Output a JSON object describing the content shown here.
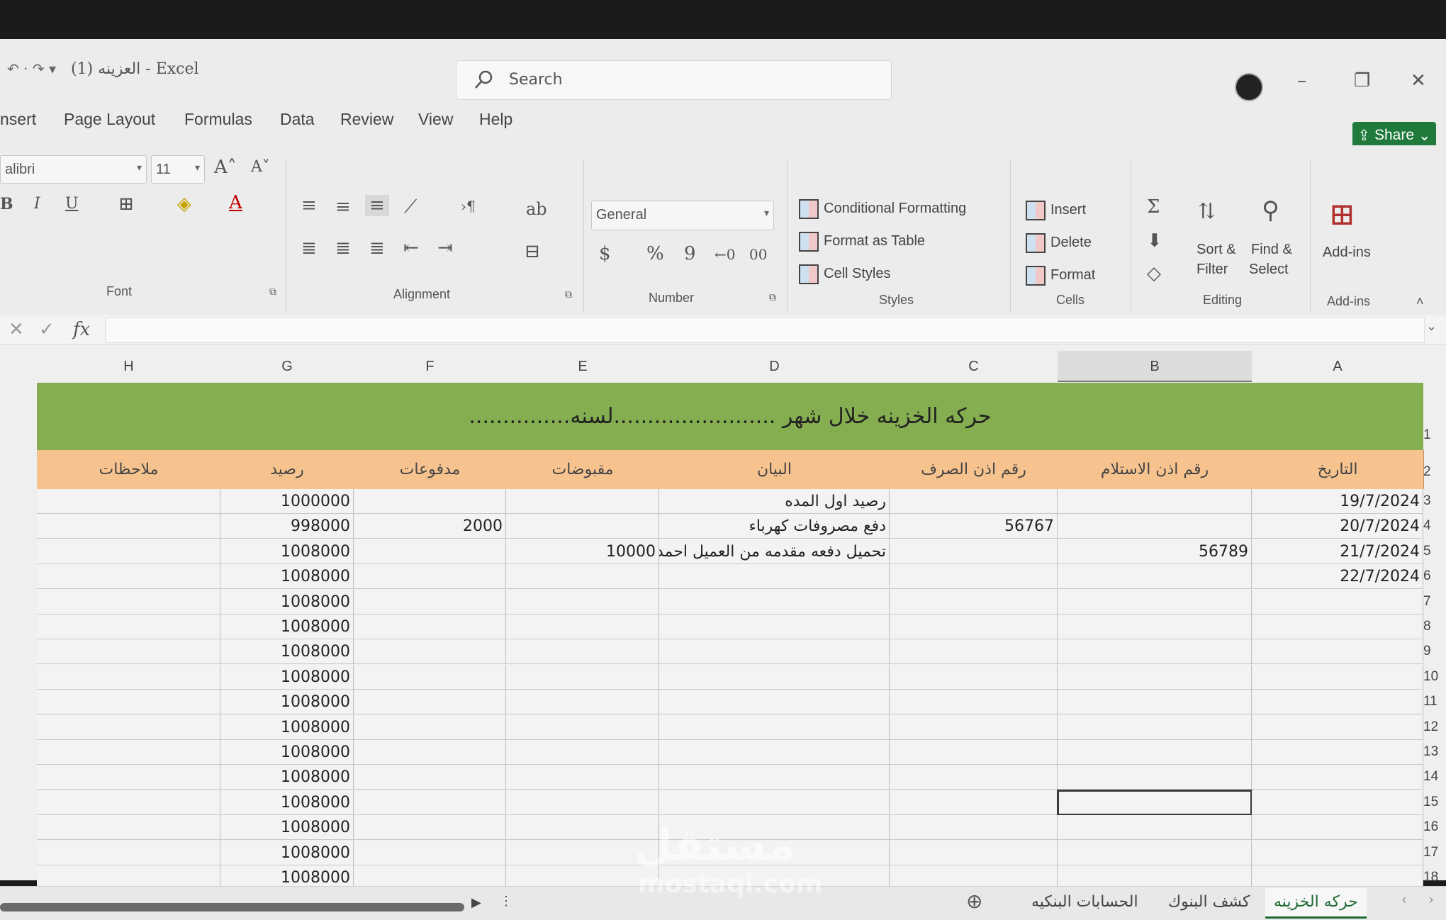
{
  "window": {
    "title": "العزينه (1)  -  Excel",
    "search_placeholder": "Search"
  },
  "menu": [
    "nsert",
    "Page Layout",
    "Formulas",
    "Data",
    "Review",
    "View",
    "Help"
  ],
  "share_label": "Share",
  "ribbon": {
    "font_name": "alibri",
    "font_size": "11",
    "number_format": "General",
    "groups": {
      "font": "Font",
      "alignment": "Alignment",
      "number": "Number",
      "styles": "Styles",
      "cells": "Cells",
      "editing": "Editing",
      "addins": "Add-ins"
    },
    "styles_items": [
      "Conditional Formatting",
      "Format as Table",
      "Cell Styles"
    ],
    "cells_items": [
      "Insert",
      "Delete",
      "Format"
    ],
    "sort_filter": [
      "Sort &",
      "Filter"
    ],
    "find_select": [
      "Find &",
      "Select"
    ],
    "addins_btn": "Add-ins"
  },
  "columns": [
    "H",
    "G",
    "F",
    "E",
    "D",
    "C",
    "B",
    "A"
  ],
  "rows": [
    "1",
    "2",
    "3",
    "4",
    "5",
    "6",
    "7",
    "8",
    "9",
    "10",
    "11",
    "12",
    "13",
    "14",
    "15",
    "16",
    "17",
    "18"
  ],
  "sheet": {
    "banner": "حركه الخزينه خلال شهر ........................لسنه...............",
    "headers": {
      "H": "ملاحظات",
      "G": "رصيد",
      "F": "مدفوعات",
      "E": "مقبوضات",
      "D": "البيان",
      "C": "رقم اذن الصرف",
      "B": "رقم اذن الاستلام",
      "A": "التاريخ"
    },
    "data_rows": [
      {
        "A": "19/7/2024",
        "B": "",
        "C": "",
        "D": "رصيد اول المده",
        "E": "",
        "F": "",
        "G": "1000000",
        "H": ""
      },
      {
        "A": "20/7/2024",
        "B": "",
        "C": "56767",
        "D": "دفع مصروفات كهرباء",
        "E": "",
        "F": "2000",
        "G": "998000",
        "H": ""
      },
      {
        "A": "21/7/2024",
        "B": "56789",
        "C": "",
        "D": "تحميل دفعه مقدمه من العميل احمد",
        "E": "10000",
        "F": "",
        "G": "1008000",
        "H": ""
      },
      {
        "A": "22/7/2024",
        "B": "",
        "C": "",
        "D": "",
        "E": "",
        "F": "",
        "G": "1008000",
        "H": ""
      },
      {
        "A": "",
        "B": "",
        "C": "",
        "D": "",
        "E": "",
        "F": "",
        "G": "1008000",
        "H": ""
      },
      {
        "A": "",
        "B": "",
        "C": "",
        "D": "",
        "E": "",
        "F": "",
        "G": "1008000",
        "H": ""
      },
      {
        "A": "",
        "B": "",
        "C": "",
        "D": "",
        "E": "",
        "F": "",
        "G": "1008000",
        "H": ""
      },
      {
        "A": "",
        "B": "",
        "C": "",
        "D": "",
        "E": "",
        "F": "",
        "G": "1008000",
        "H": ""
      },
      {
        "A": "",
        "B": "",
        "C": "",
        "D": "",
        "E": "",
        "F": "",
        "G": "1008000",
        "H": ""
      },
      {
        "A": "",
        "B": "",
        "C": "",
        "D": "",
        "E": "",
        "F": "",
        "G": "1008000",
        "H": ""
      },
      {
        "A": "",
        "B": "",
        "C": "",
        "D": "",
        "E": "",
        "F": "",
        "G": "1008000",
        "H": ""
      },
      {
        "A": "",
        "B": "",
        "C": "",
        "D": "",
        "E": "",
        "F": "",
        "G": "1008000",
        "H": ""
      },
      {
        "A": "",
        "B": "",
        "C": "",
        "D": "",
        "E": "",
        "F": "",
        "G": "1008000",
        "H": ""
      },
      {
        "A": "",
        "B": "",
        "C": "",
        "D": "",
        "E": "",
        "F": "",
        "G": "1008000",
        "H": ""
      },
      {
        "A": "",
        "B": "",
        "C": "",
        "D": "",
        "E": "",
        "F": "",
        "G": "1008000",
        "H": ""
      },
      {
        "A": "",
        "B": "",
        "C": "",
        "D": "",
        "E": "",
        "F": "",
        "G": "1008000",
        "H": ""
      }
    ]
  },
  "tabs": [
    "حركه الخزينه",
    "كشف البنوك",
    "الحسابات البنكيه"
  ],
  "watermark": {
    "ar": "مستقل",
    "en": "mostaql.com"
  },
  "colors": {
    "banner": "#84ae4f",
    "header": "#f6c38f",
    "share": "#1f7a3c"
  }
}
